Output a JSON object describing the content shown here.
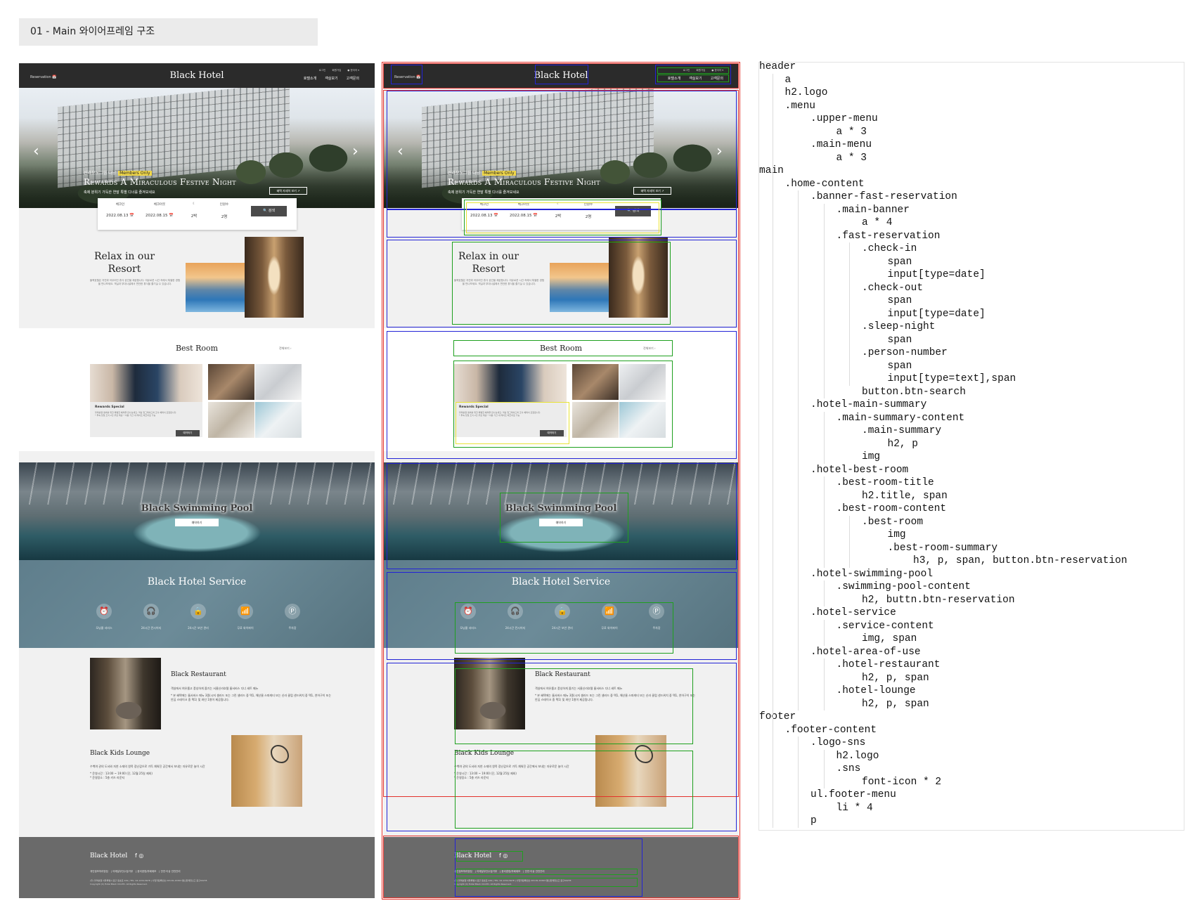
{
  "heading": "01 - Main 와이어프레임 구조",
  "mockup": {
    "header": {
      "reservation": "Reservation 📅",
      "logo": "Black Hotel",
      "upper_menu": [
        "로그인",
        "회원가입",
        "● 한국어 ▾"
      ],
      "main_menu": [
        "호텔소개",
        "객실보기",
        "고객문의"
      ]
    },
    "banner": {
      "arrow_left": "‹",
      "arrow_right": "›",
      "subtitle": "신라모노그램 다낭",
      "tag": "Members Only",
      "title": "Rewards A Miraculous Festive Night",
      "desc": "축제 분위기 가득한 연말 특별 디너를 즐겨보세요",
      "button": "혜택 자세히 보기 ↗"
    },
    "fast_reservation": {
      "check_in_label": "체크인",
      "check_in_value": "2022.08.13 📅",
      "check_out_label": "체크아웃",
      "check_out_value": "2022.08.15 📅",
      "night_label": "☾",
      "night_value": "2박",
      "person_label": "인원수",
      "person_value": "2명",
      "search_button": "🔍 검색"
    },
    "summary": {
      "title": "Relax in our Resort",
      "desc": "블랙호텔은 자연과 어우러진 휴식 공간을 제공합니다. 여유로운 시간 속에서 특별한 경험을 만나보세요. 객실과 부대시설에서 편안한 휴식을 즐기실 수 있습니다."
    },
    "best_room": {
      "title": "Best Room",
      "more": "전체보기 ›",
      "card_title": "Rewards Special",
      "card_desc": "블랙호텔 멤버를 위한 특별한 혜택을 만나보세요. 객실 업그레이드와 조식 혜택이 포함됩니다.",
      "card_notes": "* 투숙 당일 조식 2인 무료 제공  * 이용 기간 내 레이트 체크아웃 가능",
      "card_button": "예약하기"
    },
    "pool": {
      "title": "Black Swimming Pool",
      "button": "예약하기"
    },
    "service": {
      "title": "Black Hotel Service",
      "items": [
        {
          "icon": "⏰",
          "label": "모닝콜 서비스"
        },
        {
          "icon": "🎧",
          "label": "24시간 컨시어지"
        },
        {
          "icon": "🔒",
          "label": "24시간 보안 관리"
        },
        {
          "icon": "📶",
          "label": "무료 와이파이"
        },
        {
          "icon": "Ⓟ",
          "label": "주차장"
        }
      ]
    },
    "restaurant": {
      "title": "Black Restaurant",
      "desc": "객실에서 여유롭고 풍성하게 즐기는 서울신라호텔 룸서비스 디너 세트 메뉴",
      "note": "* 본 혜택에는 룸서비스 메뉴 3종(시저 샐러드 또는 그린 샐러드 중 택1, 해산물 스파게티 또는 신라 클럽 샌드위치 중 택1, 연어구이 또는 안심 스테이크 중 택1) 및 와인 1병이 제공됩니다."
    },
    "lounge": {
      "title": "Black Kids Lounge",
      "desc": "수백여 권의 도서와 자연 소재의 원목 장난감으로 가득 채워진 공간에서 보내는 자유로운 놀이 시간",
      "hours": "* 운영시간 : 13:00 ~ 19:00 (단, 12월 25일 제외)",
      "place": "* 운영장소 : 5층 키즈 라운지"
    },
    "footer": {
      "logo": "Black Hotel",
      "sns": "f ◎",
      "menu": [
        "개인정보처리방침",
        "이메일무단수집거부",
        "윤리경영/부패제보",
        "안전·이상 안전관리"
      ],
      "address": "(주) 블랙호텔 서울특별시 중구 동호로 249 | TEL. 02-1234-5678 | 사업자등록번호 203-81-43363 통신판매업신고 중구00278",
      "copyright": "Copyright (C) Hotel Black CO.LTD. All Rights Reserved."
    }
  },
  "tree": [
    {
      "text": "header",
      "indent": 0
    },
    {
      "text": "a",
      "indent": 1
    },
    {
      "text": "h2.logo",
      "indent": 1
    },
    {
      "text": ".menu",
      "indent": 1
    },
    {
      "text": ".upper-menu",
      "indent": 2
    },
    {
      "text": "a * 3",
      "indent": 3
    },
    {
      "text": ".main-menu",
      "indent": 2
    },
    {
      "text": "a * 3",
      "indent": 3
    },
    {
      "text": "main",
      "indent": 0
    },
    {
      "text": ".home-content",
      "indent": 1
    },
    {
      "text": ".banner-fast-reservation",
      "indent": 2
    },
    {
      "text": ".main-banner",
      "indent": 3
    },
    {
      "text": "a * 4",
      "indent": 4
    },
    {
      "text": ".fast-reservation",
      "indent": 3
    },
    {
      "text": ".check-in",
      "indent": 4
    },
    {
      "text": "span",
      "indent": 5
    },
    {
      "text": "input[type=date]",
      "indent": 5
    },
    {
      "text": ".check-out",
      "indent": 4
    },
    {
      "text": "span",
      "indent": 5
    },
    {
      "text": "input[type=date]",
      "indent": 5
    },
    {
      "text": ".sleep-night",
      "indent": 4
    },
    {
      "text": "span",
      "indent": 5
    },
    {
      "text": ".person-number",
      "indent": 4
    },
    {
      "text": "span",
      "indent": 5
    },
    {
      "text": "input[type=text],span",
      "indent": 5
    },
    {
      "text": "button.btn-search",
      "indent": 4
    },
    {
      "text": ".hotel-main-summary",
      "indent": 2
    },
    {
      "text": ".main-summary-content",
      "indent": 3
    },
    {
      "text": ".main-summary",
      "indent": 4
    },
    {
      "text": "h2, p",
      "indent": 5
    },
    {
      "text": "img",
      "indent": 4
    },
    {
      "text": ".hotel-best-room",
      "indent": 2
    },
    {
      "text": ".best-room-title",
      "indent": 3
    },
    {
      "text": "h2.title, span",
      "indent": 4
    },
    {
      "text": ".best-room-content",
      "indent": 3
    },
    {
      "text": ".best-room",
      "indent": 4
    },
    {
      "text": "img",
      "indent": 5
    },
    {
      "text": ".best-room-summary",
      "indent": 5
    },
    {
      "text": "h3, p, span, button.btn-reservation",
      "indent": 6
    },
    {
      "text": ".hotel-swimming-pool",
      "indent": 2
    },
    {
      "text": ".swimming-pool-content",
      "indent": 3
    },
    {
      "text": "h2, buttn.btn-reservation",
      "indent": 4
    },
    {
      "text": ".hotel-service",
      "indent": 2
    },
    {
      "text": ".service-content",
      "indent": 3
    },
    {
      "text": "img, span",
      "indent": 4
    },
    {
      "text": ".hotel-area-of-use",
      "indent": 2
    },
    {
      "text": ".hotel-restaurant",
      "indent": 3
    },
    {
      "text": "h2, p, span",
      "indent": 4
    },
    {
      "text": ".hotel-lounge",
      "indent": 3
    },
    {
      "text": "h2, p, span",
      "indent": 4
    },
    {
      "text": "footer",
      "indent": 0
    },
    {
      "text": ".footer-content",
      "indent": 1
    },
    {
      "text": ".logo-sns",
      "indent": 2
    },
    {
      "text": "h2.logo",
      "indent": 3
    },
    {
      "text": ".sns",
      "indent": 3
    },
    {
      "text": "font-icon * 2",
      "indent": 4
    },
    {
      "text": "ul.footer-menu",
      "indent": 2
    },
    {
      "text": "li * 4",
      "indent": 3
    },
    {
      "text": "p",
      "indent": 2
    }
  ]
}
